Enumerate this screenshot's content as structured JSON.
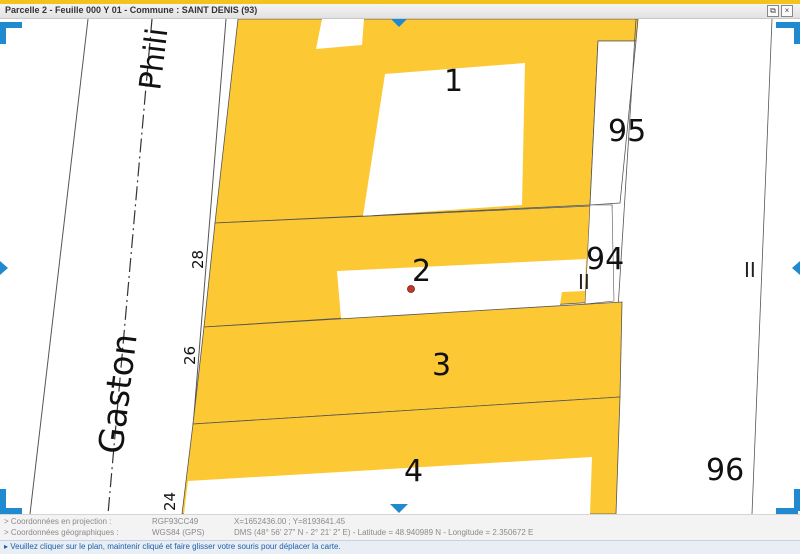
{
  "window": {
    "title": "Parcelle 2 - Feuille 000 Y 01 - Commune : SAINT DENIS (93)",
    "restore_glyph": "⧉",
    "close_glyph": "×"
  },
  "map": {
    "street_labels": [
      "Phili",
      "Gaston"
    ],
    "house_numbers": [
      "28",
      "26",
      "24"
    ],
    "parcel_labels": [
      "1",
      "2",
      "3",
      "4",
      "95",
      "94",
      "96"
    ],
    "boundary_marks": [
      "II",
      "II"
    ],
    "colors": {
      "built": "#fcc834",
      "unbuilt": "#ffffff",
      "lines": "#444444",
      "marker": "#c0392b",
      "nav": "#1f8ad0"
    },
    "nav_arrows": [
      "pan-north-icon",
      "pan-south-icon",
      "pan-west-icon",
      "pan-east-icon"
    ]
  },
  "coords": {
    "projection": {
      "label": "> Coordonnées en projection :",
      "system": "RGF93CC49",
      "value": "X=1652436.00 ; Y=8193641.45"
    },
    "geographic": {
      "label": "> Coordonnées géographiques :",
      "system": "WGS84 (GPS)",
      "value": "DMS (48° 56' 27\" N - 2° 21' 2\" E) - Latitude = 48.940989 N - Longitude = 2.350672 E"
    }
  },
  "status": {
    "arrow": "▸",
    "text": "Veuillez cliquer sur le plan, maintenir cliqué et faire glisser votre souris pour déplacer la carte."
  }
}
